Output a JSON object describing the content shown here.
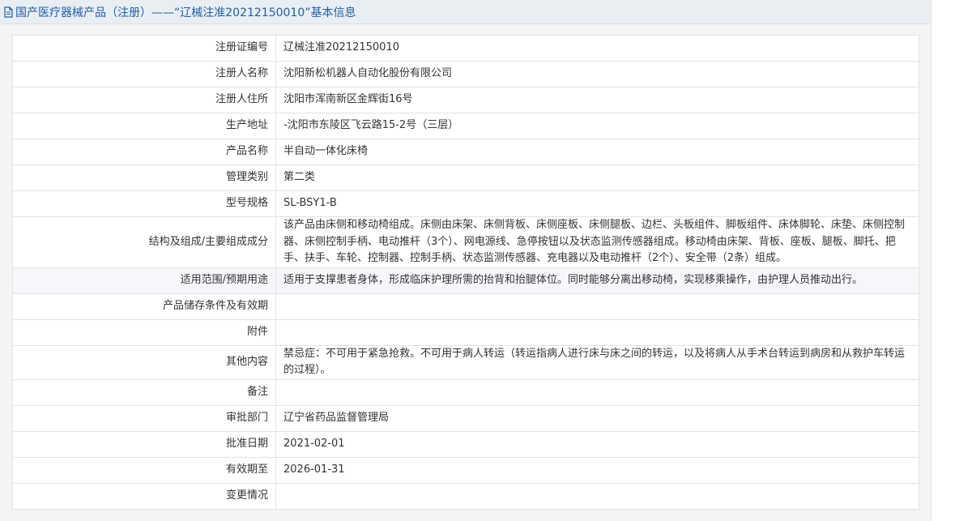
{
  "header": {
    "title": "国产医疗器械产品（注册）——“辽械注准20212150010”基本信息",
    "icon": "document-icon"
  },
  "colors": {
    "title": "#1f5fa9",
    "header_bg": "#e9eef3",
    "border": "#e3e3e3"
  },
  "rows": [
    {
      "label": "注册证编号",
      "value": "辽械注准20212150010"
    },
    {
      "label": "注册人名称",
      "value": "沈阳新松机器人自动化股份有限公司"
    },
    {
      "label": "注册人住所",
      "value": "沈阳市浑南新区金辉街16号"
    },
    {
      "label": "生产地址",
      "value": "-沈阳市东陵区飞云路15-2号（三层）"
    },
    {
      "label": "产品名称",
      "value": "半自动一体化床椅"
    },
    {
      "label": "管理类别",
      "value": "第二类"
    },
    {
      "label": "型号规格",
      "value": "SL-BSY1-B"
    },
    {
      "label": "结构及组成/主要组成成分",
      "value": "该产品由床侧和移动椅组成。床侧由床架、床侧背板、床侧座板、床侧腿板、边栏、头板组件、脚板组件、床体脚轮、床垫、床侧控制器、床侧控制手柄、电动推杆（3个）、网电源线、急停按钮以及状态监测传感器组成。移动椅由床架、背板、座板、腿板、脚托、把手、扶手、车轮、控制器、控制手柄、状态监测传感器、充电器以及电动推杆（2个）、安全带（2条）组成。"
    },
    {
      "label": "适用范围/预期用途",
      "value": "适用于支撑患者身体，形成临床护理所需的抬背和抬腿体位。同时能够分离出移动椅，实现移乘操作，由护理人员推动出行。"
    },
    {
      "label": "产品储存条件及有效期",
      "value": ""
    },
    {
      "label": "附件",
      "value": ""
    },
    {
      "label": "其他内容",
      "value": "禁忌症：不可用于紧急抢救。不可用于病人转运（转运指病人进行床与床之间的转运，以及将病人从手术台转运到病房和从救护车转运的过程）。"
    },
    {
      "label": "备注",
      "value": ""
    },
    {
      "label": "审批部门",
      "value": "辽宁省药品监督管理局"
    },
    {
      "label": "批准日期",
      "value": "2021-02-01"
    },
    {
      "label": "有效期至",
      "value": "2026-01-31"
    },
    {
      "label": "变更情况",
      "value": ""
    }
  ]
}
